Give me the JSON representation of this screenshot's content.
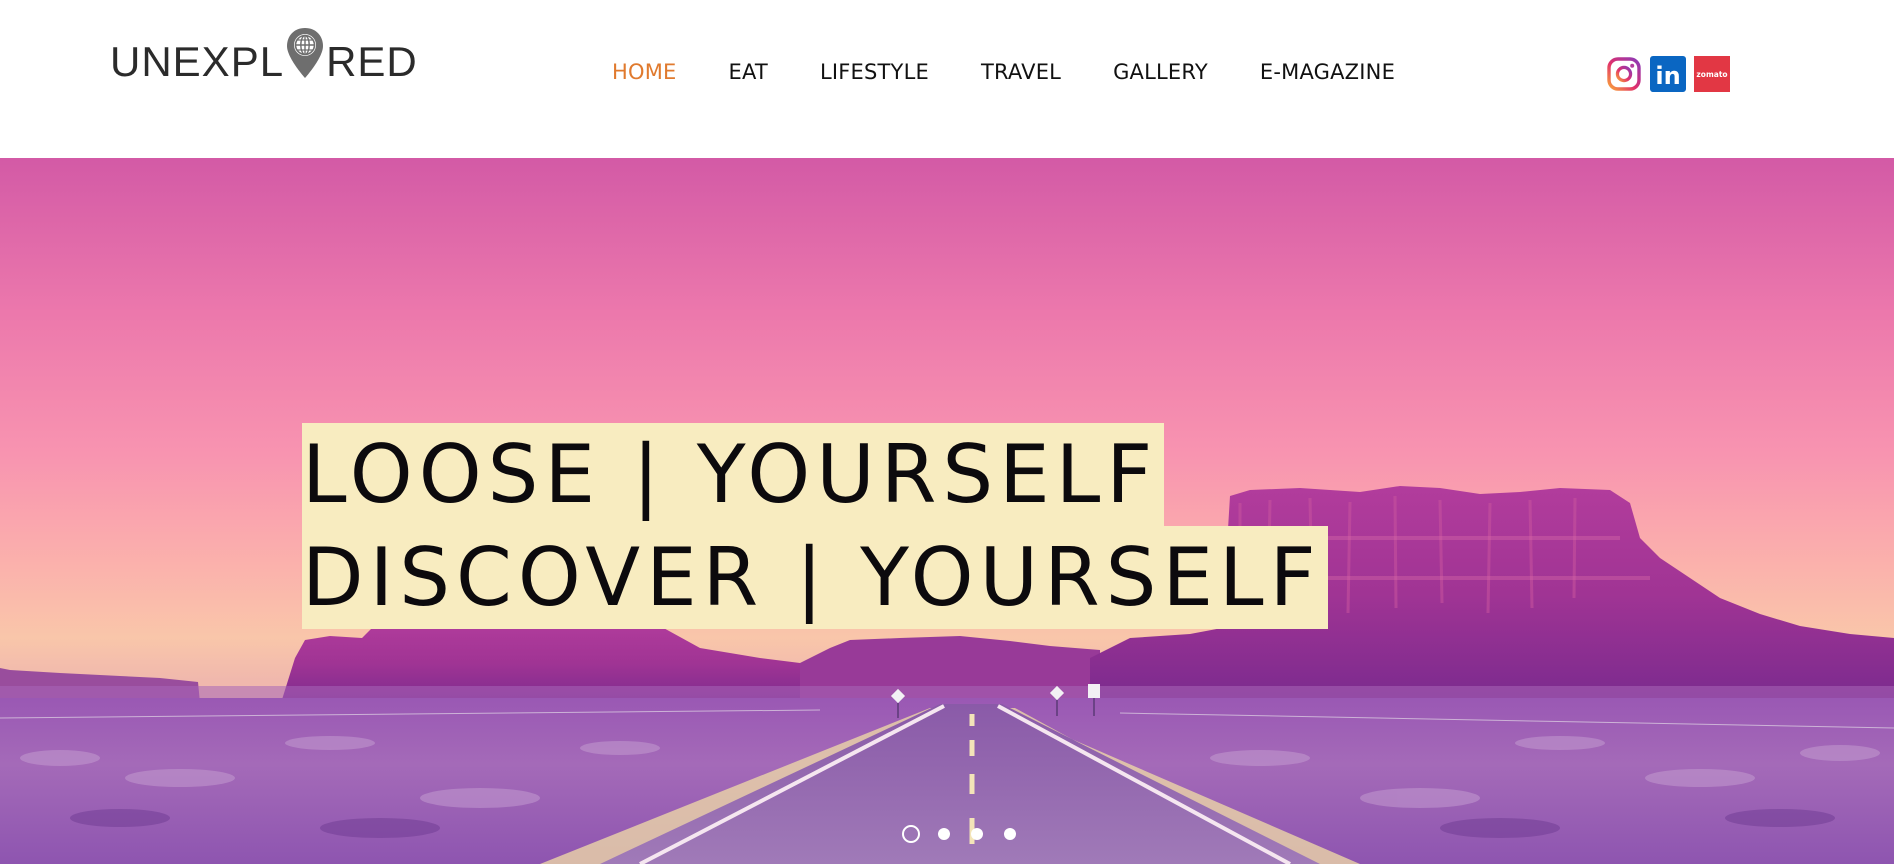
{
  "brand": {
    "logo_left": "UNEXPL",
    "logo_right": "RED",
    "logo_mark_icon": "globe-pin-icon"
  },
  "nav": {
    "items": [
      {
        "label": "HOME",
        "active": true
      },
      {
        "label": "EAT",
        "active": false
      },
      {
        "label": "LIFESTYLE",
        "active": false
      },
      {
        "label": "TRAVEL",
        "active": false
      },
      {
        "label": "GALLERY",
        "active": false
      },
      {
        "label": "E-MAGAZINE",
        "active": false
      }
    ],
    "active_color": "#e07a2e"
  },
  "social": [
    {
      "name": "instagram",
      "icon": "instagram-icon"
    },
    {
      "name": "linkedin",
      "icon": "linkedin-icon",
      "glyph": "in",
      "color": "#0a66c2"
    },
    {
      "name": "zomato",
      "icon": "zomato-icon",
      "glyph": "zomato",
      "color": "#e23744"
    }
  ],
  "hero": {
    "line1": "LOOSE | YOURSELF",
    "line2": "DISCOVER | YOURSELF",
    "highlight_color": "#f8ecc0",
    "slides": 4,
    "active_slide": 1
  }
}
